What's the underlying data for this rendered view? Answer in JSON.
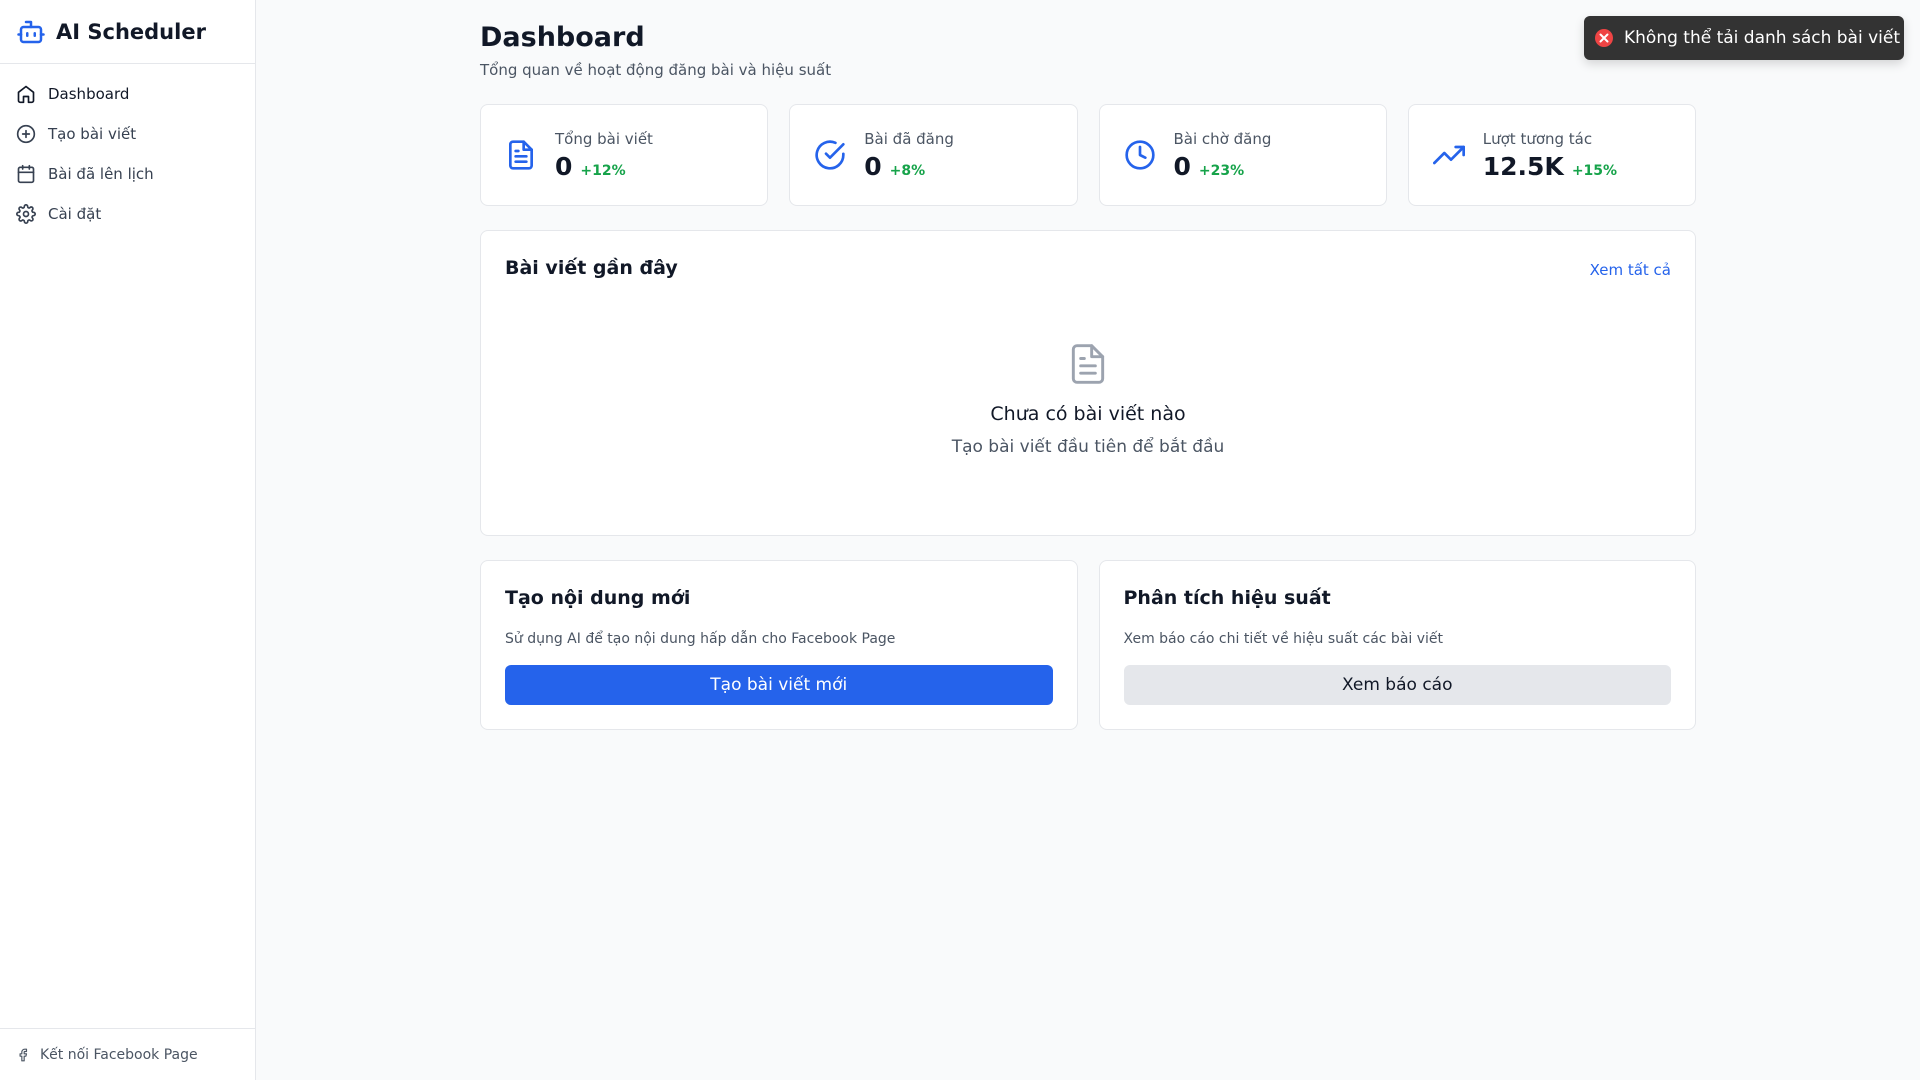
{
  "app": {
    "title": "AI Scheduler",
    "brand_icon": "robot-icon"
  },
  "sidebar": {
    "items": [
      {
        "label": "Dashboard",
        "icon": "home-icon",
        "active": true
      },
      {
        "label": "Tạo bài viết",
        "icon": "plus-circle-icon",
        "active": false
      },
      {
        "label": "Bài đã lên lịch",
        "icon": "calendar-icon",
        "active": false
      },
      {
        "label": "Cài đặt",
        "icon": "gear-icon",
        "active": false
      }
    ],
    "footer": {
      "label": "Kết nối Facebook Page",
      "icon": "facebook-icon"
    }
  },
  "header": {
    "title": "Dashboard",
    "subtitle": "Tổng quan về hoạt động đăng bài và hiệu suất"
  },
  "stats": [
    {
      "label": "Tổng bài viết",
      "value": "0",
      "change": "+12%",
      "icon": "document-icon"
    },
    {
      "label": "Bài đã đăng",
      "value": "0",
      "change": "+8%",
      "icon": "check-circle-icon"
    },
    {
      "label": "Bài chờ đăng",
      "value": "0",
      "change": "+23%",
      "icon": "clock-icon"
    },
    {
      "label": "Lượt tương tác",
      "value": "12.5K",
      "change": "+15%",
      "icon": "trending-up-icon"
    }
  ],
  "recent": {
    "title": "Bài viết gần đây",
    "view_all": "Xem tất cả",
    "empty_title": "Chưa có bài viết nào",
    "empty_subtitle": "Tạo bài viết đầu tiên để bắt đầu"
  },
  "actions": {
    "create": {
      "title": "Tạo nội dung mới",
      "description": "Sử dụng AI để tạo nội dung hấp dẫn cho Facebook Page",
      "button": "Tạo bài viết mới"
    },
    "analytics": {
      "title": "Phân tích hiệu suất",
      "description": "Xem báo cáo chi tiết về hiệu suất các bài viết",
      "button": "Xem báo cáo"
    }
  },
  "toast": {
    "message": "Không thể tải danh sách bài viết",
    "icon": "error-x-icon"
  },
  "colors": {
    "accent": "#2563eb",
    "success": "#16a34a",
    "error": "#ef4444",
    "toast_bg": "#333333"
  }
}
